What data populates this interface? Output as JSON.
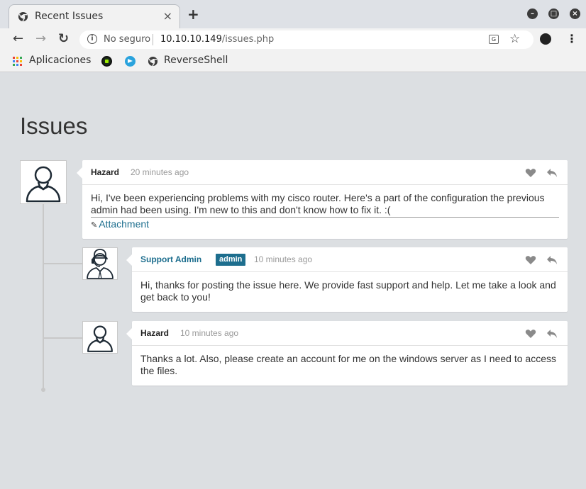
{
  "browser": {
    "tab_title": "Recent Issues",
    "tab_close": "×",
    "new_tab": "+",
    "security_text": "No seguro",
    "url_host": "10.10.10.149",
    "url_path": "/issues.php",
    "bookmarks": [
      {
        "label": "Aplicaciones",
        "icon": "apps-grid-icon"
      },
      {
        "label": "",
        "icon": "hackthebox-icon"
      },
      {
        "label": "",
        "icon": "telegram-icon"
      },
      {
        "label": "ReverseShell",
        "icon": "chrome-icon"
      }
    ]
  },
  "page": {
    "title": "Issues"
  },
  "posts": [
    {
      "author": "Hazard",
      "badge": "",
      "time": "20 minutes ago",
      "body": "Hi, I've been experiencing problems with my cisco router. Here's a part of the configuration the previous admin had been using. I'm new to this and don't know how to fix it. :(",
      "attachment": "Attachment",
      "avatar": "user-outline-icon"
    },
    {
      "author": "Support Admin",
      "badge": "admin",
      "time": "10 minutes ago",
      "body": "Hi, thanks for posting the issue here. We provide fast support and help. Let me take a look and get back to you!",
      "avatar": "support-agent-icon"
    },
    {
      "author": "Hazard",
      "badge": "",
      "time": "10 minutes ago",
      "body": "Thanks a lot. Also, please create an account for me on the windows server as I need to access the files.",
      "avatar": "user-outline-icon"
    }
  ],
  "colors": {
    "accent": "#1d6e8e",
    "page_bg": "#dcdfe2"
  }
}
